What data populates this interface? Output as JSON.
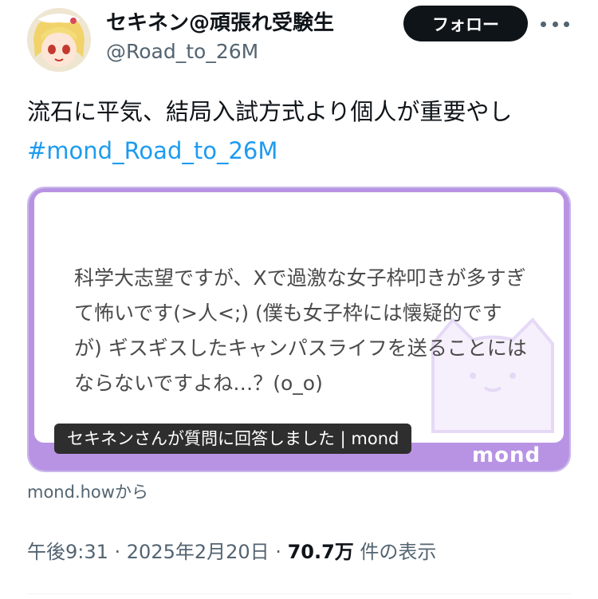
{
  "user": {
    "display_name": "セキネン@頑張れ受験生",
    "handle": "@Road_to_26M"
  },
  "follow_label": "フォロー",
  "tweet": {
    "text": "流石に平気、結局入試方式より個人が重要やし",
    "hashtag": "#mond_Road_to_26M"
  },
  "card": {
    "question": "科学大志望ですが、Xで過激な女子枠叩きが多すぎて怖いです(>人<;) (僕も女子枠には懐疑的ですが) ギスギスしたキャンパスライフを送ることにはならないですよね…？(o_o)",
    "caption": "セキネンさんが質問に回答しました | mond",
    "logo": "mond",
    "source": "mond.howから"
  },
  "meta": {
    "time": "午後9:31 · 2025年2月20日 · ",
    "views": "70.7万",
    "views_suffix": " 件の表示"
  },
  "colors": {
    "accent": "#1d9bf0",
    "card_frame": "#b893e4",
    "button_bg": "#0f1419"
  }
}
